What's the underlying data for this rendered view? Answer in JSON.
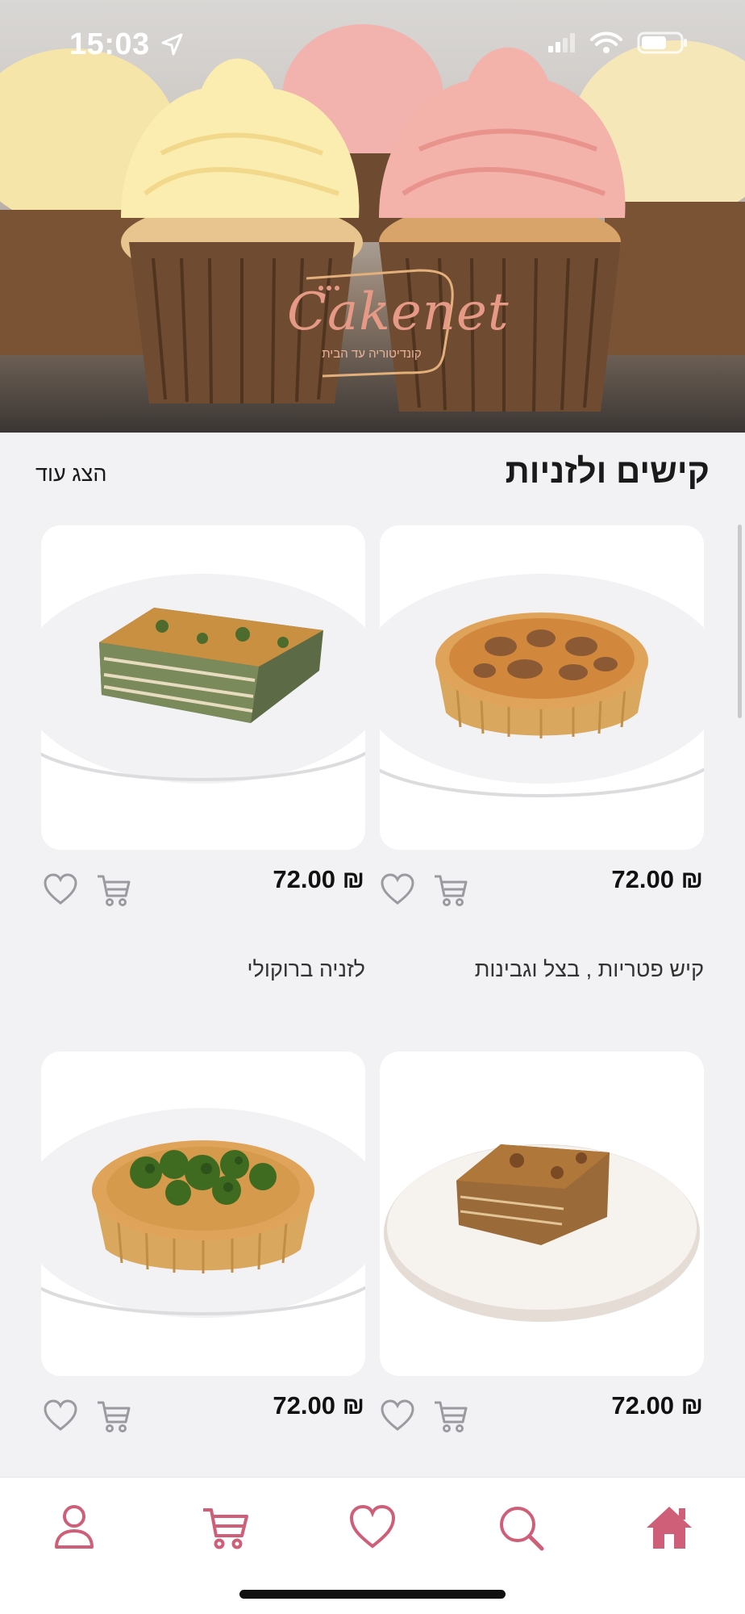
{
  "status": {
    "time": "15:03"
  },
  "hero": {
    "logo_text": "Cakenet",
    "logo_subtitle": "קונדיטוריה עד הבית"
  },
  "section": {
    "title": "קישים ולזניות",
    "show_more": "הצג עוד"
  },
  "products": [
    {
      "name": "קיש פטריות , בצל וגבינות",
      "price": "72.00 ₪"
    },
    {
      "name": "לזניה ברוקולי",
      "price": "72.00 ₪"
    },
    {
      "name": "",
      "price": "72.00 ₪"
    },
    {
      "name": "",
      "price": "72.00 ₪"
    }
  ],
  "nav": [
    "home-icon",
    "search-icon",
    "heart-icon",
    "cart-icon",
    "user-icon"
  ],
  "colors": {
    "accent": "#cf5f79",
    "icon_gray": "#9a9aa0"
  }
}
